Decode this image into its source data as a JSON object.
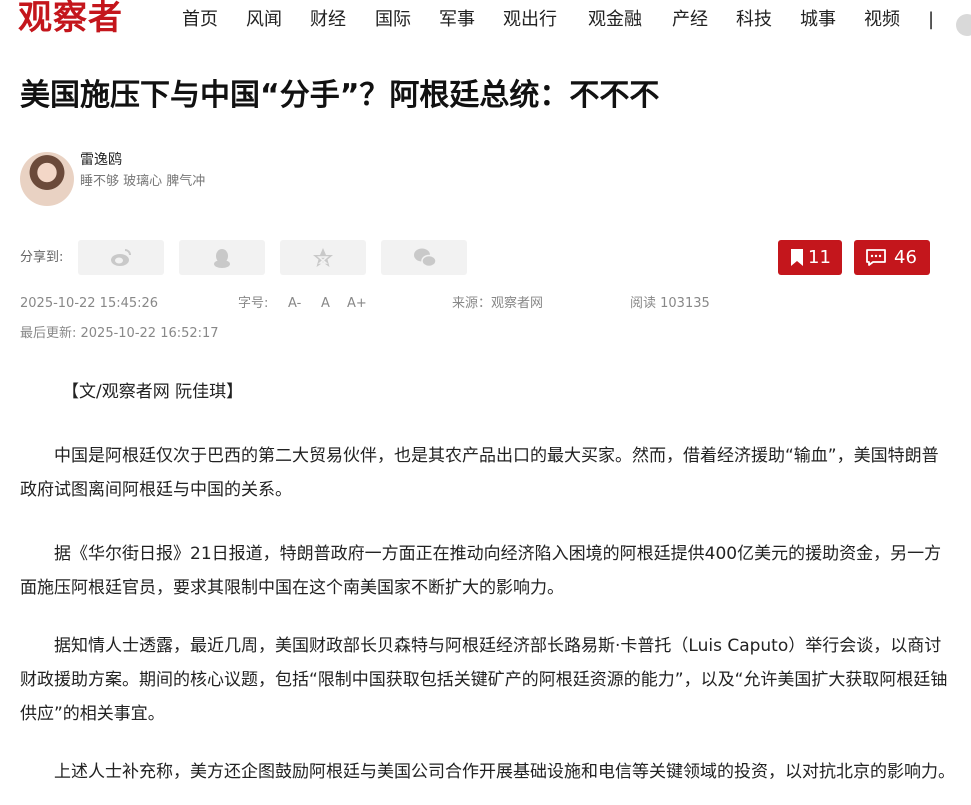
{
  "site": {
    "logo": "观察者"
  },
  "nav": {
    "items": [
      "首页",
      "风闻",
      "财经",
      "国际",
      "军事",
      "观出行",
      "观金融",
      "产经",
      "科技",
      "城事",
      "视频"
    ],
    "separator": "|"
  },
  "article": {
    "title": "美国施压下与中国“分手”？阿根廷总统：不不不",
    "author": {
      "name": "雷逸鸥",
      "bio": "睡不够 玻璃心 脾气冲"
    },
    "share": {
      "label": "分享到:",
      "targets": [
        "weibo-icon",
        "qq-icon",
        "qzone-icon",
        "wechat-icon"
      ]
    },
    "bookmarks": "11",
    "comments": "46",
    "meta": {
      "published": "2025-10-22 15:45:26",
      "font_size_label": "字号:",
      "font_size_options": [
        "A-",
        "A",
        "A+"
      ],
      "source": "来源：观察者网",
      "reads": "阅读 103135",
      "updated": "最后更新: 2025-10-22 16:52:17"
    },
    "byline": "【文/观察者网 阮佳琪】",
    "paragraphs": [
      "中国是阿根廷仅次于巴西的第二大贸易伙伴，也是其农产品出口的最大买家。然而，借着经济援助“输血”，美国特朗普政府试图离间阿根廷与中国的关系。",
      "据《华尔街日报》21日报道，特朗普政府一方面正在推动向经济陷入困境的阿根廷提供400亿美元的援助资金，另一方面施压阿根廷官员，要求其限制中国在这个南美国家不断扩大的影响力。",
      "据知情人士透露，最近几周，美国财政部长贝森特与阿根廷经济部长路易斯·卡普托（Luis Caputo）举行会谈，以商讨财政援助方案。期间的核心议题，包括“限制中国获取包括关键矿产的阿根廷资源的能力”，以及“允许美国扩大获取阿根廷铀供应”的相关事宜。",
      "上述人士补充称，美方还企图鼓励阿根廷与美国公司合作开展基础设施和电信等关键领域的投资，以对抗北京的影响力。"
    ]
  },
  "colors": {
    "accent": "#c4161c",
    "meta_gray": "#888888"
  }
}
